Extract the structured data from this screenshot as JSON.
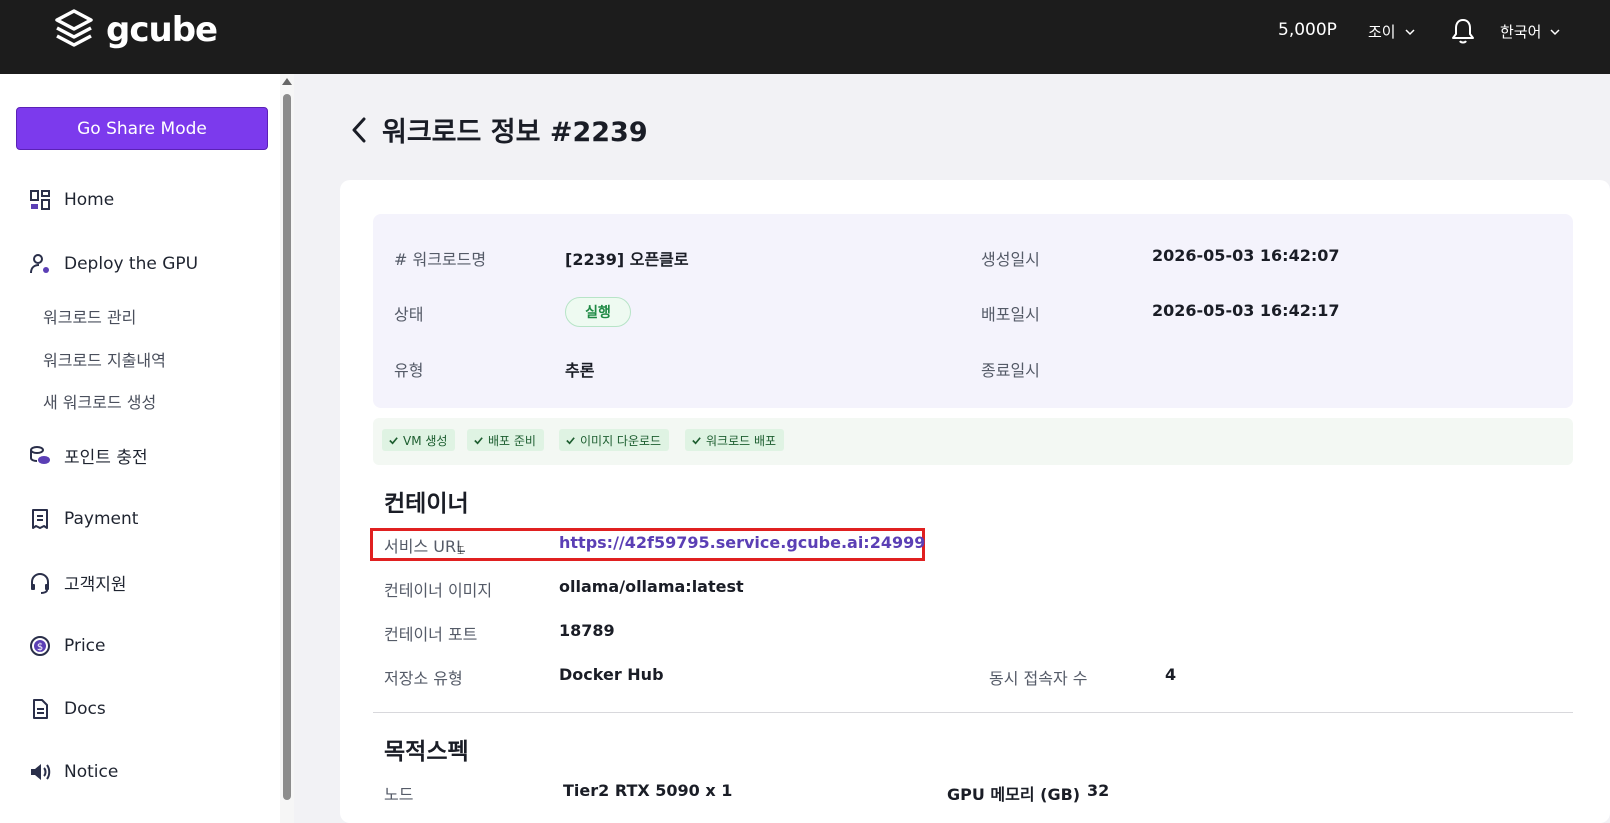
{
  "header": {
    "logo_text": "gcube",
    "points": "5,000P",
    "user_name": "조이",
    "language": "한국어"
  },
  "sidebar": {
    "share_button": "Go Share Mode",
    "items": [
      {
        "label": "Home",
        "icon": "dashboard-icon"
      },
      {
        "label": "Deploy the GPU",
        "icon": "user-gear-icon"
      },
      {
        "label": "포인트 충전",
        "icon": "coins-icon"
      },
      {
        "label": "Payment",
        "icon": "receipt-icon"
      },
      {
        "label": "고객지원",
        "icon": "headset-icon"
      },
      {
        "label": "Price",
        "icon": "dollar-circle-icon"
      },
      {
        "label": "Docs",
        "icon": "document-icon"
      },
      {
        "label": "Notice",
        "icon": "megaphone-icon"
      }
    ],
    "sub_items": [
      "워크로드 관리",
      "워크로드 지출내역",
      "새 워크로드 생성"
    ]
  },
  "page": {
    "title": "워크로드 정보 #2239"
  },
  "info": {
    "name_label": "# 워크로드명",
    "name_value": "[2239] 오픈클로",
    "created_label": "생성일시",
    "created_value": "2026-05-03 16:42:07",
    "status_label": "상태",
    "status_value": "실행",
    "deployed_label": "배포일시",
    "deployed_value": "2026-05-03 16:42:17",
    "type_label": "유형",
    "type_value": "추론",
    "ended_label": "종료일시",
    "ended_value": ""
  },
  "steps": [
    "VM 생성",
    "배포 준비",
    "이미지 다운로드",
    "워크로드 배포"
  ],
  "container": {
    "title": "컨테이너",
    "service_url_label": "서비스 URL",
    "service_url_value": "https://42f59795.service.gcube.ai:24999",
    "image_label": "컨테이너 이미지",
    "image_value": "ollama/ollama:latest",
    "port_label": "컨테이너 포트",
    "port_value": "18789",
    "repo_label": "저장소 유형",
    "repo_value": "Docker Hub",
    "concurrent_label": "동시 접속자 수",
    "concurrent_value": "4"
  },
  "spec": {
    "title": "목적스펙",
    "node_label": "노드",
    "node_value": "Tier2 RTX 5090 x 1",
    "gpu_mem_label": "GPU 메모리 (GB)",
    "gpu_mem_value": "32"
  },
  "colors": {
    "accent": "#7c3aed",
    "link": "#5b3fb5",
    "highlight": "#e02020",
    "status_green": "#1f8a45"
  }
}
